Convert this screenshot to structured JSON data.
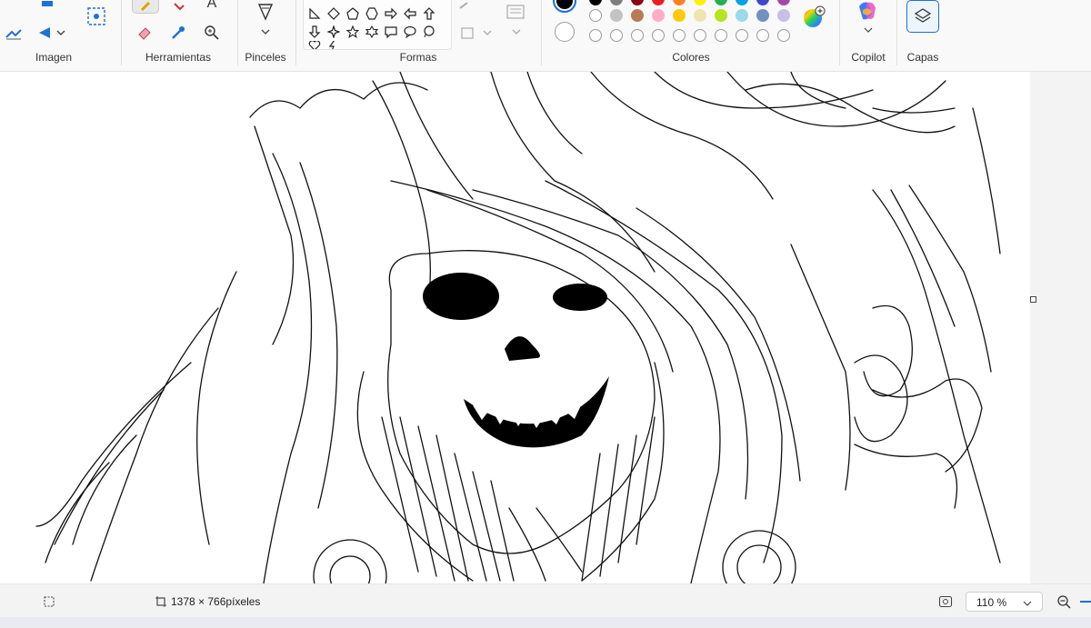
{
  "ribbon": {
    "groups": {
      "image": "Imagen",
      "tools": "Herramientas",
      "brushes": "Pinceles",
      "shapes": "Formas",
      "colors": "Colores",
      "copilot": "Copilot",
      "layers": "Capas"
    },
    "text_tool_glyph": "A",
    "palette_row1": [
      "#000000",
      "#7f7f7f",
      "#880015",
      "#ed1c24",
      "#ff7f27",
      "#fff200",
      "#22b14c",
      "#00a2e8",
      "#3f48cc",
      "#a349a4"
    ],
    "palette_row2": [
      "#ffffff",
      "#c3c3c3",
      "#b97a57",
      "#ffaec9",
      "#ffc90e",
      "#efe4b0",
      "#b5e61d",
      "#99d9ea",
      "#7092be",
      "#c8bfe7"
    ],
    "primary_color": "#000000",
    "secondary_color": "#ffffff"
  },
  "status": {
    "canvas_size": "1378 × 766píxeles",
    "zoom": "110 %"
  },
  "canvas": {
    "content_description_icon": "skull-sketch-drawing"
  }
}
